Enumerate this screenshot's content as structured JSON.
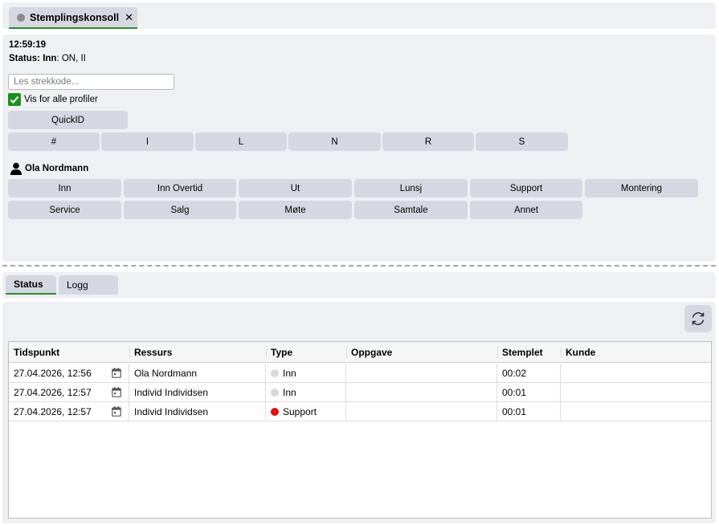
{
  "tab": {
    "title": "Stemplingskonsoll",
    "close": "✕"
  },
  "console": {
    "clock": "12:59:19",
    "status_label": "Status:",
    "status_strong": "Inn",
    "status_rest": ": ON, II",
    "barcode_placeholder": "Les strekkode...",
    "show_all_label": "Vis for alle profiler",
    "show_all_checked": true,
    "quickid_label": "QuickID",
    "filters": [
      "#",
      "I",
      "L",
      "N",
      "R",
      "S"
    ],
    "person": "Ola Nordmann",
    "actions": [
      "Inn",
      "Inn Overtid",
      "Ut",
      "Lunsj",
      "Support",
      "Montering",
      "Service",
      "Salg",
      "Møte",
      "Samtale",
      "Annet"
    ]
  },
  "lower_tabs": [
    "Status",
    "Logg"
  ],
  "table": {
    "columns": [
      "Tidspunkt",
      "Ressurs",
      "Type",
      "Oppgave",
      "Stemplet",
      "Kunde"
    ],
    "rows": [
      {
        "time": "27.04.2026, 12:56",
        "resource": "Ola Nordmann",
        "type": "Inn",
        "type_color": "#d9d9d9",
        "task": "",
        "stamped": "00:02",
        "customer": ""
      },
      {
        "time": "27.04.2026, 12:57",
        "resource": "Individ Individsen",
        "type": "Inn",
        "type_color": "#d9d9d9",
        "task": "",
        "stamped": "00:01",
        "customer": ""
      },
      {
        "time": "27.04.2026, 12:57",
        "resource": "Individ Individsen",
        "type": "Support",
        "type_color": "#e01010",
        "task": "",
        "stamped": "00:01",
        "customer": ""
      }
    ]
  },
  "colors": {
    "accent": "#2e8b2e",
    "button": "#d5d8e0",
    "panel": "#eff0f3"
  },
  "icons": {
    "refresh": "refresh-icon",
    "calendar": "calendar-icon",
    "person": "person-icon"
  }
}
